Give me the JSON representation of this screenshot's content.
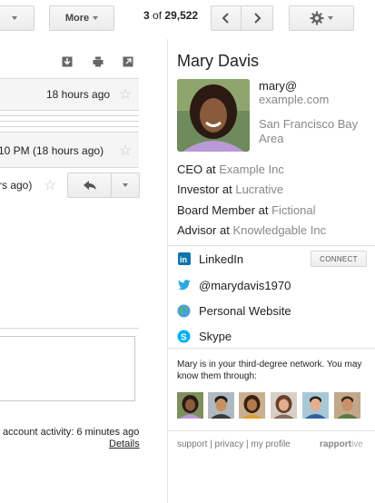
{
  "toolbar": {
    "more_label": "More",
    "pagination_current": "3",
    "pagination_of": "of",
    "pagination_total": "29,522"
  },
  "messages": {
    "row1_time": "18 hours ago",
    "row2_time": "10 PM (18 hours ago)",
    "row3_time": "rs ago)",
    "activity": "account activity: 6 minutes ago",
    "details_label": "Details"
  },
  "contact": {
    "name": "Mary Davis",
    "email_user": "mary@",
    "email_domain": "example.com",
    "location": "San Francisco Bay Area",
    "jobs": [
      {
        "title": "CEO",
        "at": "at",
        "org": "Example Inc"
      },
      {
        "title": "Investor",
        "at": "at",
        "org": "Lucrative"
      },
      {
        "title": "Board Member",
        "at": "at",
        "org": "Fictional"
      },
      {
        "title": "Advisor",
        "at": "at",
        "org": "Knowledgable Inc"
      }
    ],
    "social": {
      "linkedin": "LinkedIn",
      "connect": "CONNECT",
      "twitter": "@marydavis1970",
      "website": "Personal Website",
      "skype": "Skype"
    },
    "network_text": "Mary is in your third-degree network. You may know them through:"
  },
  "footer": {
    "support": "support",
    "sep1": "|",
    "privacy": "privacy",
    "sep2": "|",
    "profile": "my profile",
    "brand_bold": "rapport",
    "brand_light": "ive"
  },
  "colors": {
    "linkedin": "#0e76a8",
    "twitter": "#2aa9e0",
    "skype": "#00aff0",
    "muted_text": "#888888"
  }
}
